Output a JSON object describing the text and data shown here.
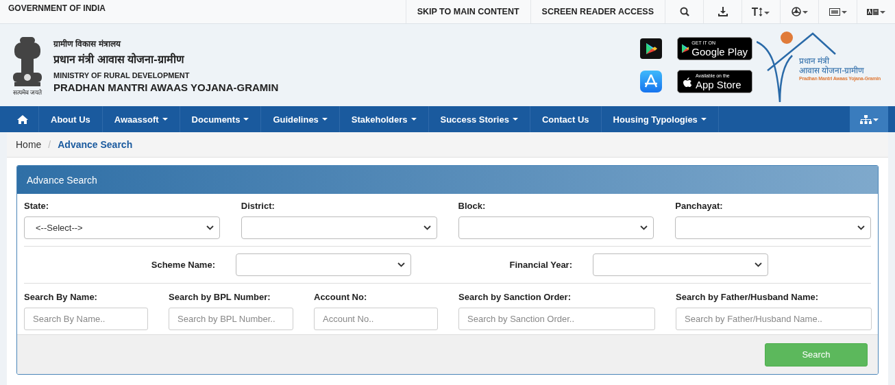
{
  "top_bar": {
    "title": "GOVERNMENT OF INDIA",
    "links": [
      "SKIP TO MAIN CONTENT",
      "SCREEN READER ACCESS"
    ]
  },
  "header": {
    "emblem_caption": "सत्यमेव जयते",
    "ministry_hindi": "ग्रामीण विकास मंत्रालय",
    "scheme_hindi": "प्रधान मंत्री आवास योजना-ग्रामीण",
    "ministry": "MINISTRY OF RURAL DEVELOPMENT",
    "scheme": "PRADHAN MANTRI AWAAS YOJANA-GRAMIN",
    "stores": [
      {
        "kind": "google",
        "small": "GET IT ON",
        "big": "Google Play"
      },
      {
        "kind": "apple",
        "small": "Available on the",
        "big": "App Store"
      }
    ],
    "logo": {
      "line1": "प्रधान मंत्री",
      "line2": "आवास योजना-ग्रामीण",
      "line3": "Pradhan Mantri Awaas Yojana-Gramin"
    }
  },
  "nav": {
    "items": [
      {
        "label": "About Us",
        "dropdown": false
      },
      {
        "label": "Awaassoft",
        "dropdown": true
      },
      {
        "label": "Documents",
        "dropdown": true
      },
      {
        "label": "Guidelines",
        "dropdown": true
      },
      {
        "label": "Stakeholders",
        "dropdown": true
      },
      {
        "label": "Success Stories",
        "dropdown": true
      },
      {
        "label": "Contact Us",
        "dropdown": false
      },
      {
        "label": "Housing Typologies",
        "dropdown": true
      }
    ]
  },
  "breadcrumb": {
    "separator": "/",
    "items": [
      {
        "label": "Home",
        "current": false
      },
      {
        "label": "Advance Search",
        "current": true
      }
    ]
  },
  "panel": {
    "title": "Advance Search",
    "location_fields": [
      {
        "label": "State:",
        "value": "<--Select-->"
      },
      {
        "label": "District:"
      },
      {
        "label": "Block:"
      },
      {
        "label": "Panchayat:"
      }
    ],
    "scheme_fields": [
      {
        "label": "Scheme Name:"
      },
      {
        "label": "Financial Year:"
      }
    ],
    "search_fields": [
      {
        "label": "Search By Name:",
        "placeholder": "Search By Name.."
      },
      {
        "label": "Search by BPL Number:",
        "placeholder": "Search by BPL Number.."
      },
      {
        "label": "Account No:",
        "placeholder": "Account No.."
      },
      {
        "label": "Search by Sanction Order:",
        "placeholder": "Search by Sanction Order.."
      },
      {
        "label": "Search by Father/Husband Name:",
        "placeholder": "Search by Father/Husband Name.."
      }
    ],
    "button": "Search"
  }
}
